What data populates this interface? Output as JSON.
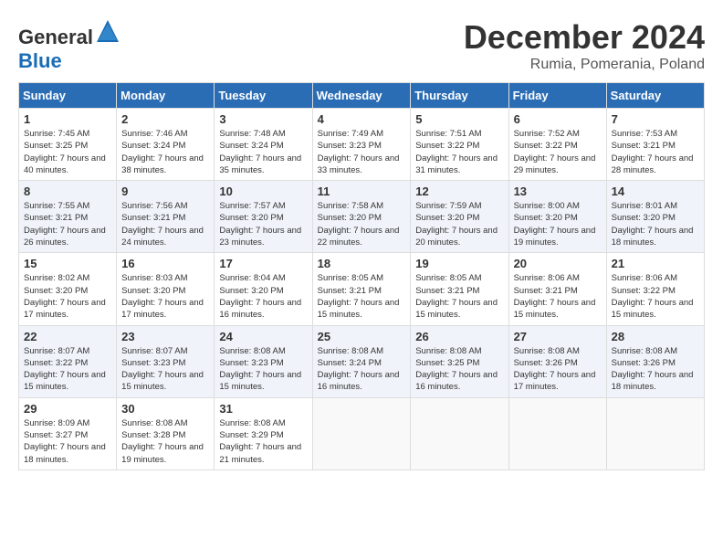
{
  "header": {
    "logo_general": "General",
    "logo_blue": "Blue",
    "month": "December 2024",
    "location": "Rumia, Pomerania, Poland"
  },
  "columns": [
    "Sunday",
    "Monday",
    "Tuesday",
    "Wednesday",
    "Thursday",
    "Friday",
    "Saturday"
  ],
  "weeks": [
    [
      {
        "day": "1",
        "sunrise": "7:45 AM",
        "sunset": "3:25 PM",
        "daylight": "7 hours and 40 minutes."
      },
      {
        "day": "2",
        "sunrise": "7:46 AM",
        "sunset": "3:24 PM",
        "daylight": "7 hours and 38 minutes."
      },
      {
        "day": "3",
        "sunrise": "7:48 AM",
        "sunset": "3:24 PM",
        "daylight": "7 hours and 35 minutes."
      },
      {
        "day": "4",
        "sunrise": "7:49 AM",
        "sunset": "3:23 PM",
        "daylight": "7 hours and 33 minutes."
      },
      {
        "day": "5",
        "sunrise": "7:51 AM",
        "sunset": "3:22 PM",
        "daylight": "7 hours and 31 minutes."
      },
      {
        "day": "6",
        "sunrise": "7:52 AM",
        "sunset": "3:22 PM",
        "daylight": "7 hours and 29 minutes."
      },
      {
        "day": "7",
        "sunrise": "7:53 AM",
        "sunset": "3:21 PM",
        "daylight": "7 hours and 28 minutes."
      }
    ],
    [
      {
        "day": "8",
        "sunrise": "7:55 AM",
        "sunset": "3:21 PM",
        "daylight": "7 hours and 26 minutes."
      },
      {
        "day": "9",
        "sunrise": "7:56 AM",
        "sunset": "3:21 PM",
        "daylight": "7 hours and 24 minutes."
      },
      {
        "day": "10",
        "sunrise": "7:57 AM",
        "sunset": "3:20 PM",
        "daylight": "7 hours and 23 minutes."
      },
      {
        "day": "11",
        "sunrise": "7:58 AM",
        "sunset": "3:20 PM",
        "daylight": "7 hours and 22 minutes."
      },
      {
        "day": "12",
        "sunrise": "7:59 AM",
        "sunset": "3:20 PM",
        "daylight": "7 hours and 20 minutes."
      },
      {
        "day": "13",
        "sunrise": "8:00 AM",
        "sunset": "3:20 PM",
        "daylight": "7 hours and 19 minutes."
      },
      {
        "day": "14",
        "sunrise": "8:01 AM",
        "sunset": "3:20 PM",
        "daylight": "7 hours and 18 minutes."
      }
    ],
    [
      {
        "day": "15",
        "sunrise": "8:02 AM",
        "sunset": "3:20 PM",
        "daylight": "7 hours and 17 minutes."
      },
      {
        "day": "16",
        "sunrise": "8:03 AM",
        "sunset": "3:20 PM",
        "daylight": "7 hours and 17 minutes."
      },
      {
        "day": "17",
        "sunrise": "8:04 AM",
        "sunset": "3:20 PM",
        "daylight": "7 hours and 16 minutes."
      },
      {
        "day": "18",
        "sunrise": "8:05 AM",
        "sunset": "3:21 PM",
        "daylight": "7 hours and 15 minutes."
      },
      {
        "day": "19",
        "sunrise": "8:05 AM",
        "sunset": "3:21 PM",
        "daylight": "7 hours and 15 minutes."
      },
      {
        "day": "20",
        "sunrise": "8:06 AM",
        "sunset": "3:21 PM",
        "daylight": "7 hours and 15 minutes."
      },
      {
        "day": "21",
        "sunrise": "8:06 AM",
        "sunset": "3:22 PM",
        "daylight": "7 hours and 15 minutes."
      }
    ],
    [
      {
        "day": "22",
        "sunrise": "8:07 AM",
        "sunset": "3:22 PM",
        "daylight": "7 hours and 15 minutes."
      },
      {
        "day": "23",
        "sunrise": "8:07 AM",
        "sunset": "3:23 PM",
        "daylight": "7 hours and 15 minutes."
      },
      {
        "day": "24",
        "sunrise": "8:08 AM",
        "sunset": "3:23 PM",
        "daylight": "7 hours and 15 minutes."
      },
      {
        "day": "25",
        "sunrise": "8:08 AM",
        "sunset": "3:24 PM",
        "daylight": "7 hours and 16 minutes."
      },
      {
        "day": "26",
        "sunrise": "8:08 AM",
        "sunset": "3:25 PM",
        "daylight": "7 hours and 16 minutes."
      },
      {
        "day": "27",
        "sunrise": "8:08 AM",
        "sunset": "3:26 PM",
        "daylight": "7 hours and 17 minutes."
      },
      {
        "day": "28",
        "sunrise": "8:08 AM",
        "sunset": "3:26 PM",
        "daylight": "7 hours and 18 minutes."
      }
    ],
    [
      {
        "day": "29",
        "sunrise": "8:09 AM",
        "sunset": "3:27 PM",
        "daylight": "7 hours and 18 minutes."
      },
      {
        "day": "30",
        "sunrise": "8:08 AM",
        "sunset": "3:28 PM",
        "daylight": "7 hours and 19 minutes."
      },
      {
        "day": "31",
        "sunrise": "8:08 AM",
        "sunset": "3:29 PM",
        "daylight": "7 hours and 21 minutes."
      },
      null,
      null,
      null,
      null
    ]
  ]
}
